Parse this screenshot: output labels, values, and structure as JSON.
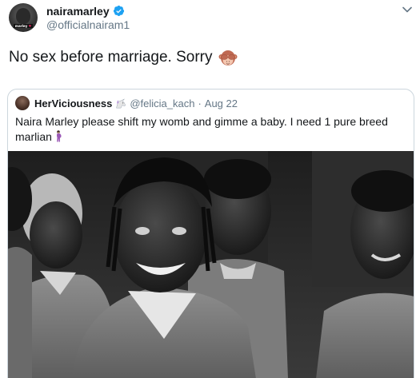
{
  "author": {
    "display_name": "nairamarley",
    "handle": "@officialnairam1",
    "verified": true,
    "avatar_tag": "marley",
    "avatar_tag_accent": "♥"
  },
  "tweet": {
    "text": "No sex before marriage. Sorry",
    "emoji": "see-no-evil-monkey"
  },
  "quoted_tweet": {
    "display_name": "HerViciousness",
    "name_emoji": "unicorn",
    "handle": "@felicia_kach",
    "separator": "·",
    "date": "Aug 22",
    "text": "Naira Marley please shift my womb and gimme a baby. I need 1 pure breed marlian",
    "text_emoji": "pregnant-woman",
    "image": "black-and-white photo of smiling men in prison uniforms"
  },
  "colors": {
    "text_primary": "#14171a",
    "text_secondary": "#657786",
    "verified_blue": "#1da1f2",
    "border": "#ccd6dd"
  }
}
